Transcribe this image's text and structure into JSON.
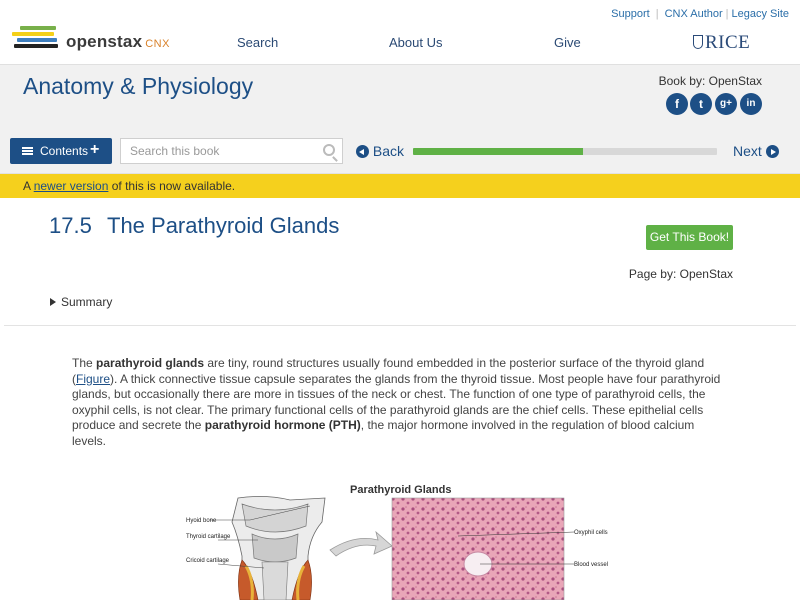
{
  "header": {
    "logo_word": "openstax",
    "logo_cnx": "CNX",
    "utility": [
      "Support",
      "CNX Author",
      "Legacy Site"
    ],
    "nav": [
      "Search",
      "About Us",
      "Give"
    ],
    "rice": "RICE",
    "colors": {
      "brand": "#1d4f86",
      "logo_orange": "#d9822b"
    }
  },
  "book": {
    "title": "Anatomy & Physiology",
    "book_by": "Book by: OpenStax",
    "social": [
      {
        "icon": "facebook-icon",
        "glyph": "f"
      },
      {
        "icon": "twitter-icon",
        "glyph": "t"
      },
      {
        "icon": "google-plus-icon",
        "glyph": "g+"
      },
      {
        "icon": "linkedin-icon",
        "glyph": "in"
      }
    ]
  },
  "toolbar": {
    "contents_label": "Contents",
    "contents_plus": "+",
    "search_placeholder": "Search this book",
    "back_label": "Back",
    "next_label": "Next",
    "progress_fraction": 0.56,
    "progress_color": "#5fb146"
  },
  "notice": {
    "prefix": "A ",
    "link": "newer version",
    "suffix": " of this is now available.",
    "color": "#f5d01d"
  },
  "section": {
    "number": "17.5",
    "title": "The Parathyroid Glands",
    "get_book": "Get This Book!",
    "page_by": "Page by: OpenStax",
    "summary": "Summary"
  },
  "body": {
    "p1_a": "The ",
    "p1_b1": "parathyroid glands",
    "p1_c": " are tiny, round structures usually found embedded in the posterior surface of the thyroid gland (",
    "p1_link": "Figure",
    "p1_d": "). A thick connective tissue capsule separates the glands from the thyroid tissue. Most people have four parathyroid glands, but occasionally there are more in tissues of the neck or chest. The function of one type of parathyroid cells, the oxyphil cells, is not clear. The primary functional cells of the parathyroid glands are the chief cells. These epithelial cells produce and secrete the ",
    "p1_b2": "parathyroid hormone (PTH)",
    "p1_e": ", the major hormone involved in the regulation of blood calcium levels."
  },
  "figure": {
    "title": "Parathyroid Glands",
    "labels_left": [
      "Hyoid bone",
      "Thyroid cartilage",
      "Cricoid cartilage"
    ],
    "labels_right": [
      "Oxyphil cells",
      "Blood vessel"
    ]
  }
}
